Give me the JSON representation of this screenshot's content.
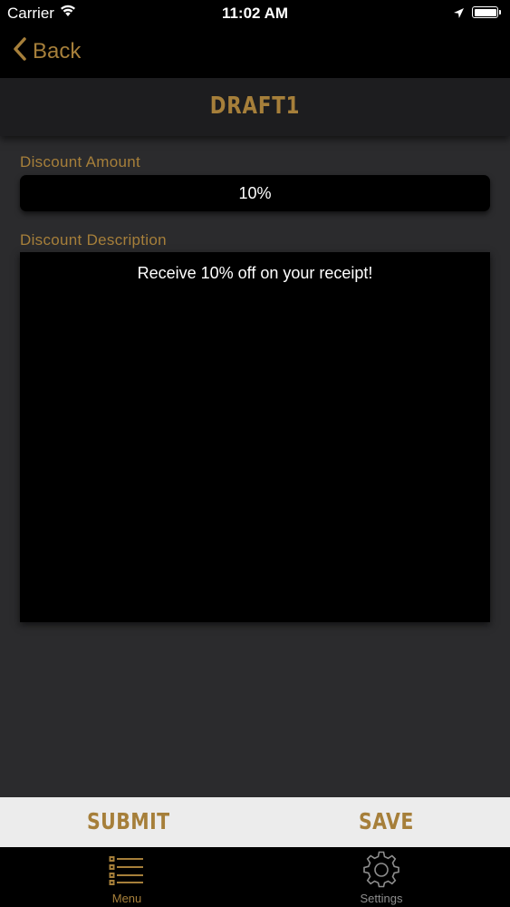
{
  "status_bar": {
    "carrier": "Carrier",
    "time": "11:02 AM",
    "icons": [
      "wifi-icon",
      "location-arrow-icon",
      "battery-icon"
    ]
  },
  "nav": {
    "back_label": "Back",
    "back_icon": "chevron-left-icon"
  },
  "page": {
    "title": "DRAFT1"
  },
  "form": {
    "discount_amount_label": "Discount Amount",
    "discount_amount_value": "10%",
    "discount_description_label": "Discount Description",
    "discount_description_value": "Receive 10% off on your receipt!"
  },
  "actions": {
    "submit_label": "SUBMIT",
    "save_label": "SAVE"
  },
  "tabs": [
    {
      "label": "Menu",
      "icon": "list-icon",
      "active": true
    },
    {
      "label": "Settings",
      "icon": "gear-icon",
      "active": false
    }
  ],
  "colors": {
    "accent": "#a67f3a",
    "background": "#2b2b2d",
    "bar": "#000000",
    "action_bar": "#ececec",
    "inactive_tab": "#8e8e8e"
  }
}
